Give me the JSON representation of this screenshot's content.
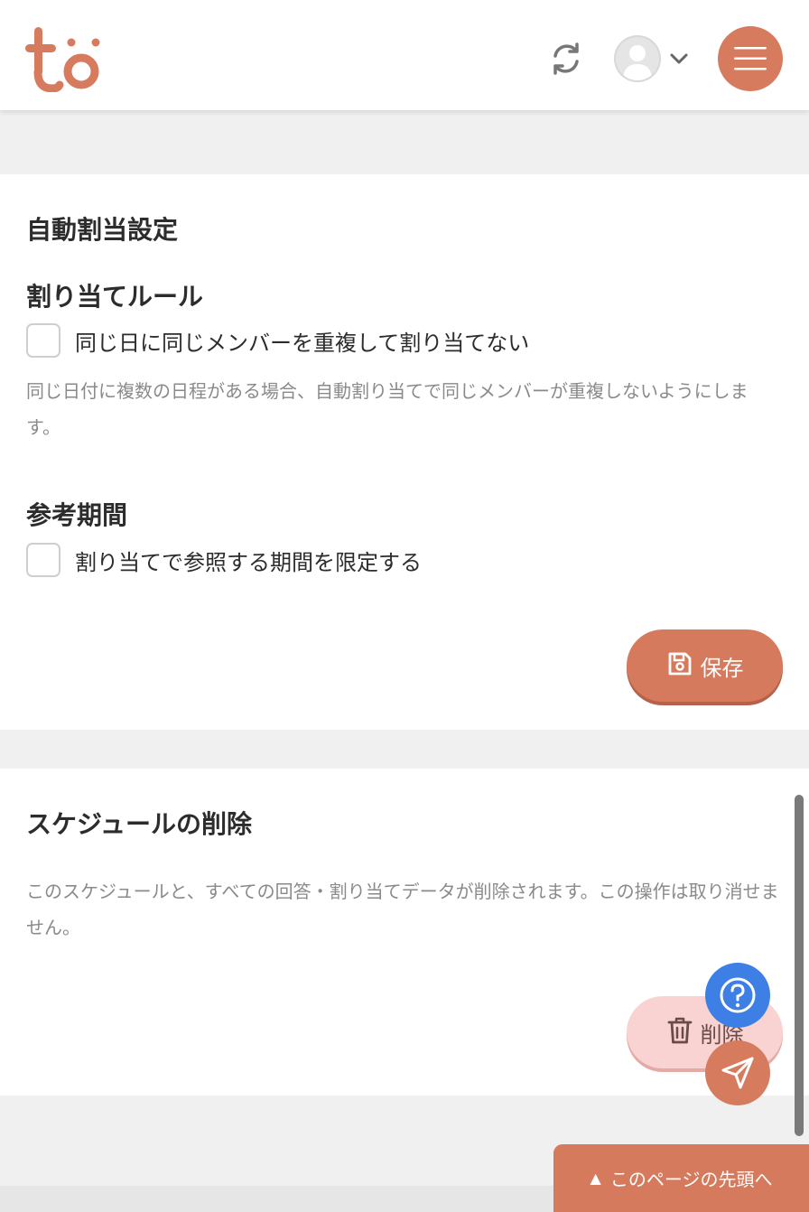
{
  "header": {
    "logo_text": "to",
    "icons": {
      "sync": "sync-icon",
      "avatar": "user-avatar-icon",
      "chevron": "chevron-down-icon",
      "menu": "hamburger-menu-icon"
    },
    "colors": {
      "brand": "#d77b5e"
    }
  },
  "auto_assign": {
    "title": "自動割当設定",
    "rule_heading": "割り当てルール",
    "rule_checkbox_label": "同じ日に同じメンバーを重複して割り当てない",
    "rule_checked": false,
    "rule_description": "同じ日付に複数の日程がある場合、自動割り当てで同じメンバーが重複しないようにします。",
    "period_heading": "参考期間",
    "period_checkbox_label": "割り当てで参照する期間を限定する",
    "period_checked": false,
    "save_label": "保存"
  },
  "delete_section": {
    "title": "スケジュールの削除",
    "description": "このスケジュールと、すべての回答・割り当てデータが削除されます。この操作は取り消せません。",
    "delete_label": "削除"
  },
  "floating": {
    "help_icon": "question-circle-icon",
    "send_icon": "paper-plane-icon",
    "help_color": "#3e7fe6"
  },
  "footer": {
    "to_top_label": "このページの先頭へ",
    "to_top_arrow": "▲"
  }
}
